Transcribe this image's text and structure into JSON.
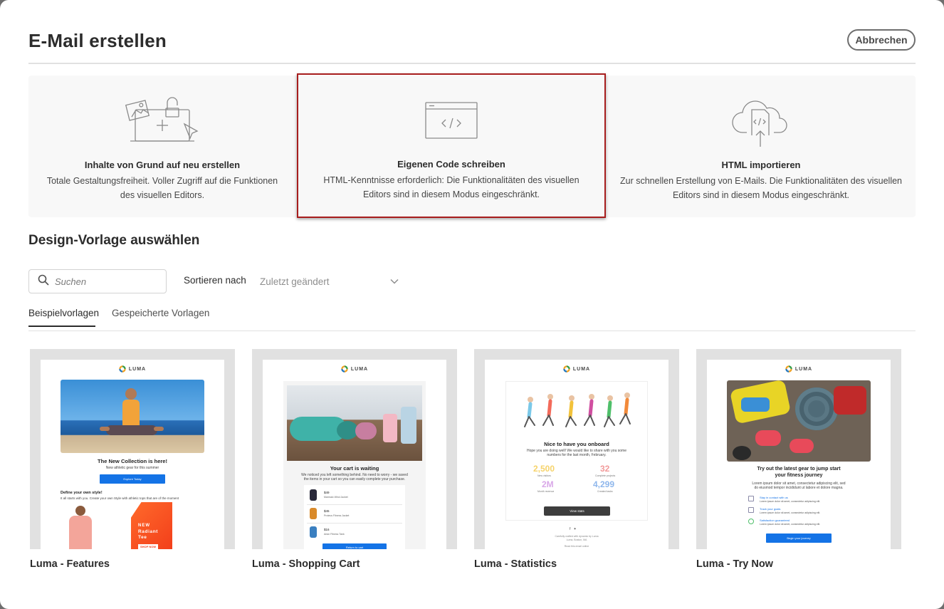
{
  "dialog": {
    "title": "E-Mail erstellen",
    "cancel_label": "Abbrechen"
  },
  "options": [
    {
      "title": "Inhalte von Grund auf neu erstellen",
      "desc_line1": "Totale Gestaltungsfreiheit. Voller Zugriff auf die Funktionen",
      "desc_line2": "des visuellen Editors.",
      "icon": "design-from-scratch-icon",
      "selected": false
    },
    {
      "title": "Eigenen Code schreiben",
      "desc_line1": "HTML-Kenntnisse erforderlich: Die Funktionalitäten des visuellen",
      "desc_line2": "Editors sind in diesem Modus eingeschränkt.",
      "icon": "code-window-icon",
      "selected": true
    },
    {
      "title": "HTML importieren",
      "desc_line1": "Zur schnellen Erstellung von E-Mails. Die Funktionalitäten des visuellen",
      "desc_line2": "Editors sind in diesem Modus eingeschränkt.",
      "icon": "cloud-upload-icon",
      "selected": false
    }
  ],
  "templates_section": {
    "heading": "Design-Vorlage auswählen",
    "search_placeholder": "Suchen",
    "sort_label": "Sortieren nach",
    "sort_value": "Zuletzt geändert",
    "tabs": [
      {
        "label": "Beispielvorlagen",
        "active": true
      },
      {
        "label": "Gespeicherte Vorlagen",
        "active": false
      }
    ]
  },
  "templates": [
    {
      "name": "Luma - Features",
      "brand": "LUMA",
      "headline": "The New Collection is here!",
      "subline": "New athletic gear for this summer",
      "button": "Explore Today",
      "section_title": "Define your own style!",
      "section_text": "It all starts with you. Create your own Style with athletic tops that are of the moment",
      "promo_line1": "NEW",
      "promo_line2": "Radiant",
      "promo_line3": "Tee",
      "promo_button": "SHOP NOW"
    },
    {
      "name": "Luma - Shopping Cart",
      "brand": "LUMA",
      "headline": "Your cart is waiting",
      "text_line1": "We noticed you left something behind. No need to worry - we saved",
      "text_line2": "the items in your cart so you can easily complete your purchase.",
      "items": [
        {
          "price": "$49",
          "label": "Marmalo Wind Jacket"
        },
        {
          "price": "$45",
          "label": "Proteus Fitness Jacket"
        },
        {
          "price": "$16",
          "label": "Arian Fitness Tank"
        }
      ],
      "button": "Return to cart"
    },
    {
      "name": "Luma - Statistics",
      "brand": "LUMA",
      "headline": "Nice to have you onboard",
      "text_line1": "Hope you are doing well! We would like to share with you some",
      "text_line2": "numbers for the last month, February.",
      "stats": [
        {
          "value": "2,500",
          "label": "New visitors",
          "color": "#f6d36b"
        },
        {
          "value": "32",
          "label": "Complete projects",
          "color": "#f29a9a"
        },
        {
          "value": "2M",
          "label": "Month revenue",
          "color": "#d9a8e8"
        },
        {
          "value": "4,299",
          "label": "Created tasks",
          "color": "#8fb7ec"
        }
      ],
      "button": "View stats",
      "footer_line1": "Carefully crafted with dynamic by Luma",
      "footer_line2": "Luma, Boston, MA",
      "footer_line3": "Read this email online"
    },
    {
      "name": "Luma - Try Now",
      "brand": "LUMA",
      "headline_line1": "Try out the latest gear to jump start",
      "headline_line2": "your fitness journey",
      "text_line1": "Lorem ipsum dolor sit amet, consectetur adipiscing elit, sed",
      "text_line2": "do eiusmod tempor incididunt ut labore et dolore magna.",
      "features": [
        {
          "title": "Stay in contact with us",
          "text": "Lorem ipsum dolor sit amet, consectetur adipiscing elit."
        },
        {
          "title": "Track your goals",
          "text": "Lorem ipsum dolor sit amet, consectetur adipiscing elit."
        },
        {
          "title": "Satisfaction guaranteed",
          "text": "Lorem ipsum dolor sit amet, consectetur adipiscing elit."
        }
      ],
      "button": "Begin your journey"
    }
  ],
  "colors": {
    "selected_border": "#a71d1d",
    "accent": "#1473e6",
    "panel_bg": "#f8f8f8",
    "thumb_bg": "#e1e1e1"
  }
}
